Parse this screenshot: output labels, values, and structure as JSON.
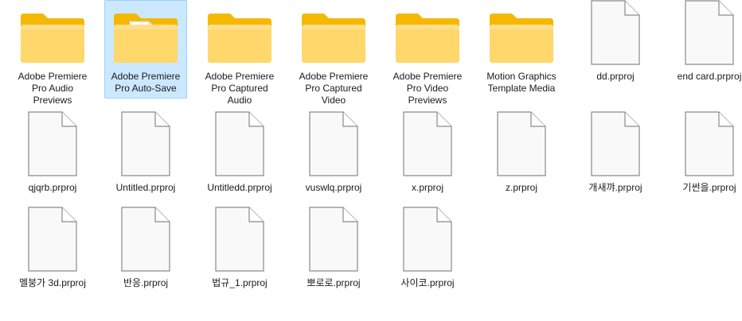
{
  "window": {
    "view": "Large icons"
  },
  "colors": {
    "folder_back": "#f5b800",
    "folder_front": "#ffd76b",
    "selection_bg": "#cce8ff",
    "selection_border": "#99d1ff",
    "file_fill": "#f9f9f9",
    "file_stroke": "#8a8a8a"
  },
  "items": [
    {
      "name": "Adobe Premiere Pro Audio Previews",
      "type": "folder",
      "icon": "folder-icon",
      "selected": false
    },
    {
      "name": "Adobe Premiere Pro Auto-Save",
      "type": "folder",
      "icon": "folder-with-document-icon",
      "selected": true
    },
    {
      "name": "Adobe Premiere Pro Captured Audio",
      "type": "folder",
      "icon": "folder-icon",
      "selected": false
    },
    {
      "name": "Adobe Premiere Pro Captured Video",
      "type": "folder",
      "icon": "folder-icon",
      "selected": false
    },
    {
      "name": "Adobe Premiere Pro Video Previews",
      "type": "folder",
      "icon": "folder-icon",
      "selected": false
    },
    {
      "name": "Motion Graphics Template Media",
      "type": "folder",
      "icon": "folder-icon",
      "selected": false
    },
    {
      "name": "dd.prproj",
      "type": "file",
      "icon": "file-icon",
      "selected": false
    },
    {
      "name": "end card.prproj",
      "type": "file",
      "icon": "file-icon",
      "selected": false
    },
    {
      "name": "qjqrb.prproj",
      "type": "file",
      "icon": "file-icon",
      "selected": false
    },
    {
      "name": "Untitled.prproj",
      "type": "file",
      "icon": "file-icon",
      "selected": false
    },
    {
      "name": "Untitledd.prproj",
      "type": "file",
      "icon": "file-icon",
      "selected": false
    },
    {
      "name": "vuswlq.prproj",
      "type": "file",
      "icon": "file-icon",
      "selected": false
    },
    {
      "name": "x.prproj",
      "type": "file",
      "icon": "file-icon",
      "selected": false
    },
    {
      "name": "z.prproj",
      "type": "file",
      "icon": "file-icon",
      "selected": false
    },
    {
      "name": "개새꺄.prproj",
      "type": "file",
      "icon": "file-icon",
      "selected": false
    },
    {
      "name": "기썬을.prproj",
      "type": "file",
      "icon": "file-icon",
      "selected": false
    },
    {
      "name": "멜붕가 3d.prproj",
      "type": "file",
      "icon": "file-icon",
      "selected": false
    },
    {
      "name": "반응.prproj",
      "type": "file",
      "icon": "file-icon",
      "selected": false
    },
    {
      "name": "법규_1.prproj",
      "type": "file",
      "icon": "file-icon",
      "selected": false
    },
    {
      "name": "뽀로로.prproj",
      "type": "file",
      "icon": "file-icon",
      "selected": false
    },
    {
      "name": "사이코.prproj",
      "type": "file",
      "icon": "file-icon",
      "selected": false
    }
  ]
}
